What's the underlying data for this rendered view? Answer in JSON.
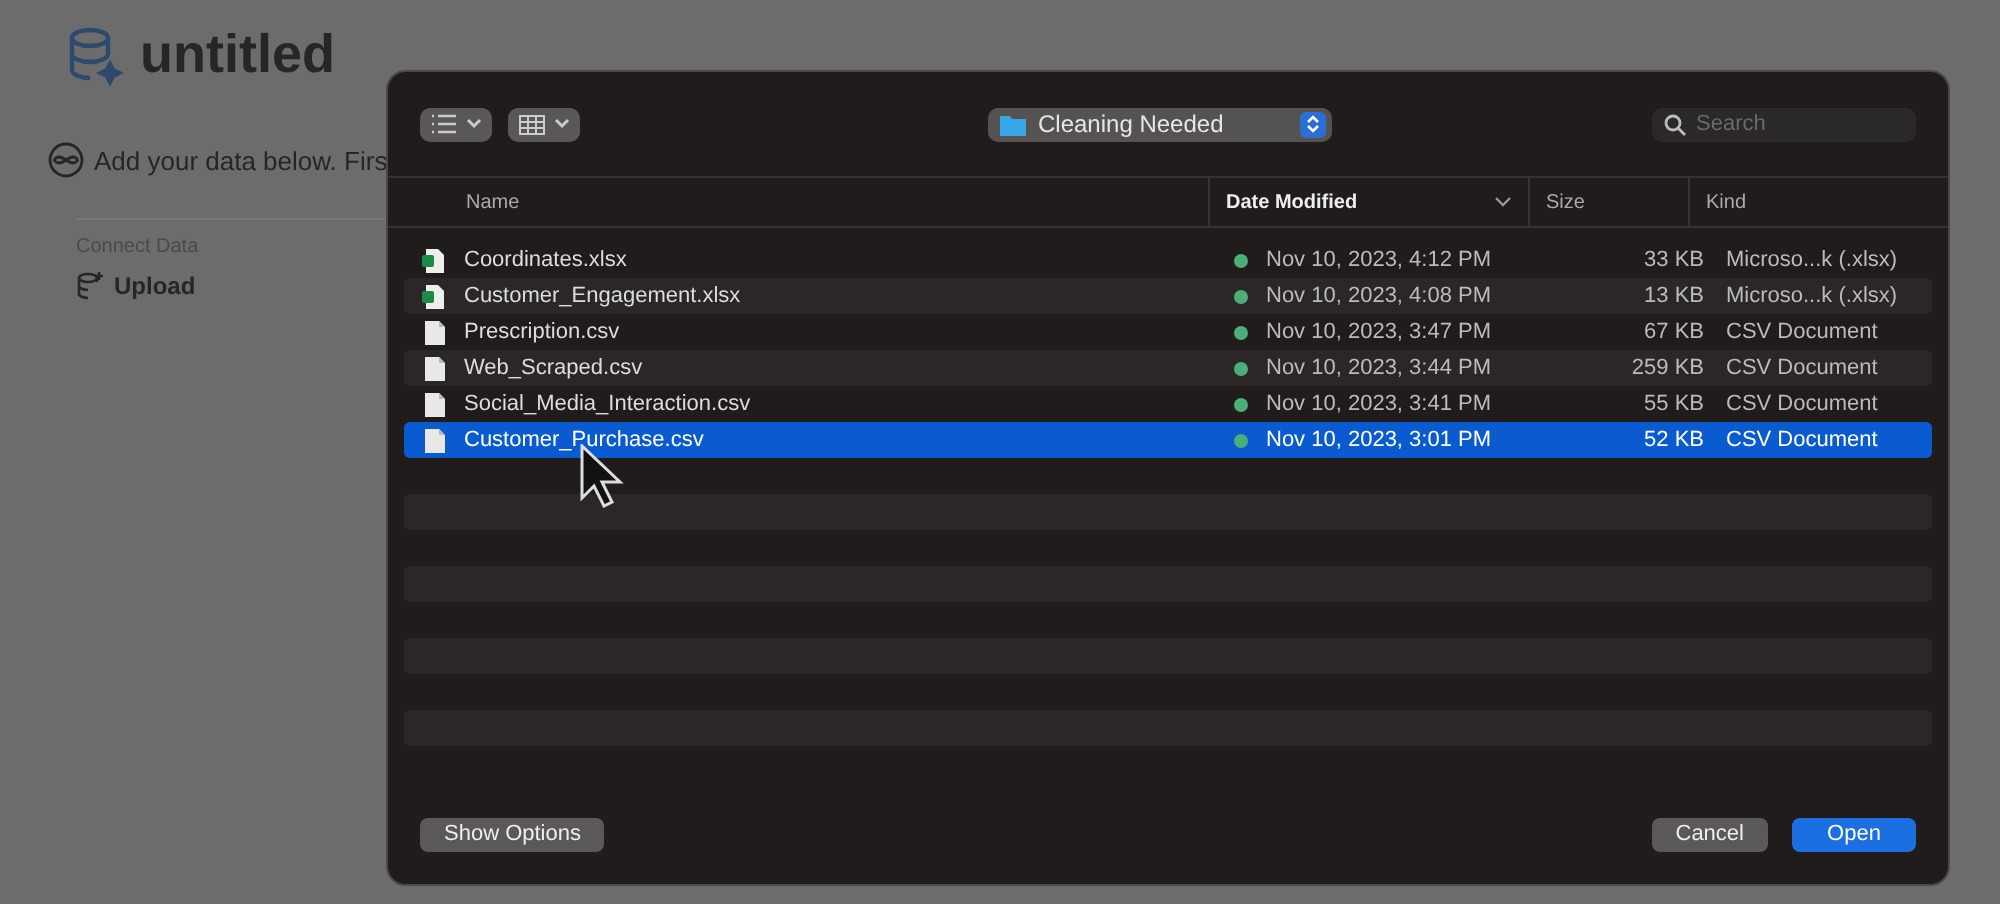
{
  "app": {
    "title": "untitled",
    "intro": "Add your data below. Firs",
    "section_label": "Connect Data",
    "upload": "Upload"
  },
  "dialog": {
    "location": "Cleaning Needed",
    "search": {
      "placeholder": "Search"
    },
    "columns": [
      {
        "label": "Name",
        "sorted": false
      },
      {
        "label": "Date Modified",
        "sorted": true
      },
      {
        "label": "Size",
        "sorted": false
      },
      {
        "label": "Kind",
        "sorted": false
      }
    ],
    "files": [
      {
        "name": "Coordinates.xlsx",
        "kind": "spreadsheet",
        "color": "#4caf78",
        "date": "Nov 10, 2023, 4:12 PM",
        "size": "33 KB",
        "type": "Microso...k (.xlsx)",
        "selected": false
      },
      {
        "name": "Customer_Engagement.xlsx",
        "kind": "spreadsheet",
        "color": "#4caf78",
        "date": "Nov 10, 2023, 4:08 PM",
        "size": "13 KB",
        "type": "Microso...k (.xlsx)",
        "selected": false
      },
      {
        "name": "Prescription.csv",
        "kind": "document",
        "color": "#4caf78",
        "date": "Nov 10, 2023, 3:47 PM",
        "size": "67 KB",
        "type": "CSV Document",
        "selected": false
      },
      {
        "name": "Web_Scraped.csv",
        "kind": "document",
        "color": "#4caf78",
        "date": "Nov 10, 2023, 3:44 PM",
        "size": "259 KB",
        "type": "CSV Document",
        "selected": false
      },
      {
        "name": "Social_Media_Interaction.csv",
        "kind": "document",
        "color": "#4caf78",
        "date": "Nov 10, 2023, 3:41 PM",
        "size": "55 KB",
        "type": "CSV Document",
        "selected": false
      },
      {
        "name": "Customer_Purchase.csv",
        "kind": "document",
        "color": "#4caf78",
        "date": "Nov 10, 2023, 3:01 PM",
        "size": "52 KB",
        "type": "CSV Document",
        "selected": true
      }
    ],
    "buttons": [
      {
        "label": "Show Options",
        "kind": "secondary"
      },
      {
        "label": "Cancel",
        "kind": "secondary"
      },
      {
        "label": "Open",
        "kind": "primary"
      }
    ]
  }
}
